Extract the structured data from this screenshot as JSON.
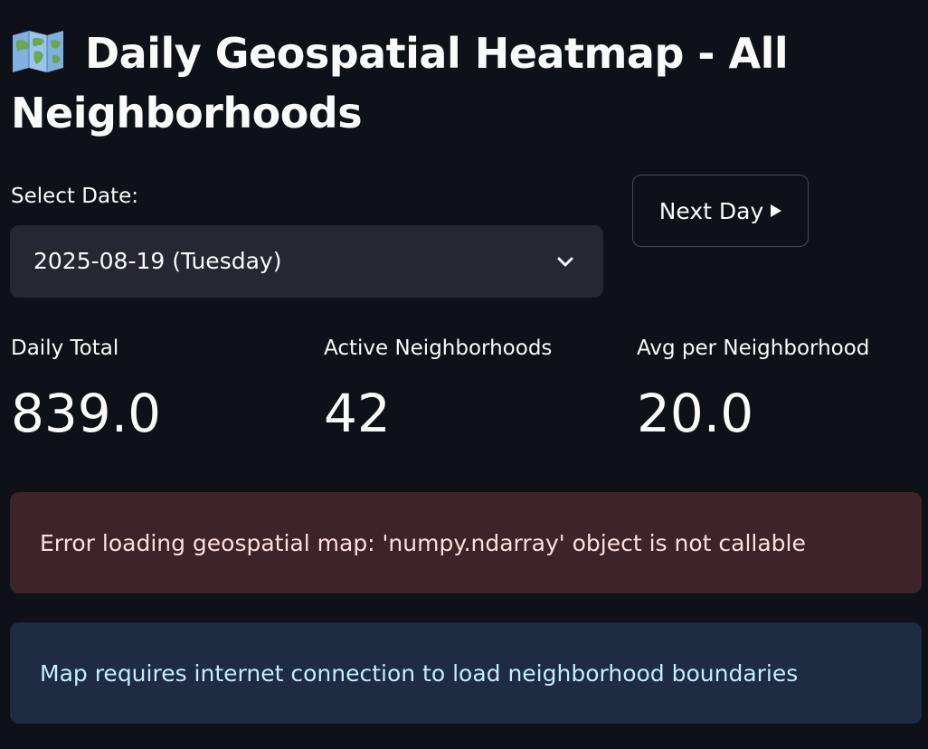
{
  "page": {
    "title_icon": "world-map-icon",
    "title": "Daily Geospatial Heatmap - All Neighborhoods"
  },
  "date_select": {
    "label": "Select Date:",
    "value": "2025-08-19 (Tuesday)",
    "icon": "chevron-down-icon"
  },
  "next_button": {
    "label": "Next Day",
    "icon": "play-triangle-icon"
  },
  "metrics": [
    {
      "label": "Daily Total",
      "value": "839.0"
    },
    {
      "label": "Active Neighborhoods",
      "value": "42"
    },
    {
      "label": "Avg per Neighborhood",
      "value": "20.0"
    }
  ],
  "alerts": {
    "error": "Error loading geospatial map: 'numpy.ndarray' object is not callable",
    "info": "Map requires internet connection to load neighborhood boundaries"
  },
  "colors": {
    "background": "#0e1117",
    "select_bg": "#262730",
    "error_bg": "#3e2428",
    "info_bg": "#1d2b43"
  }
}
